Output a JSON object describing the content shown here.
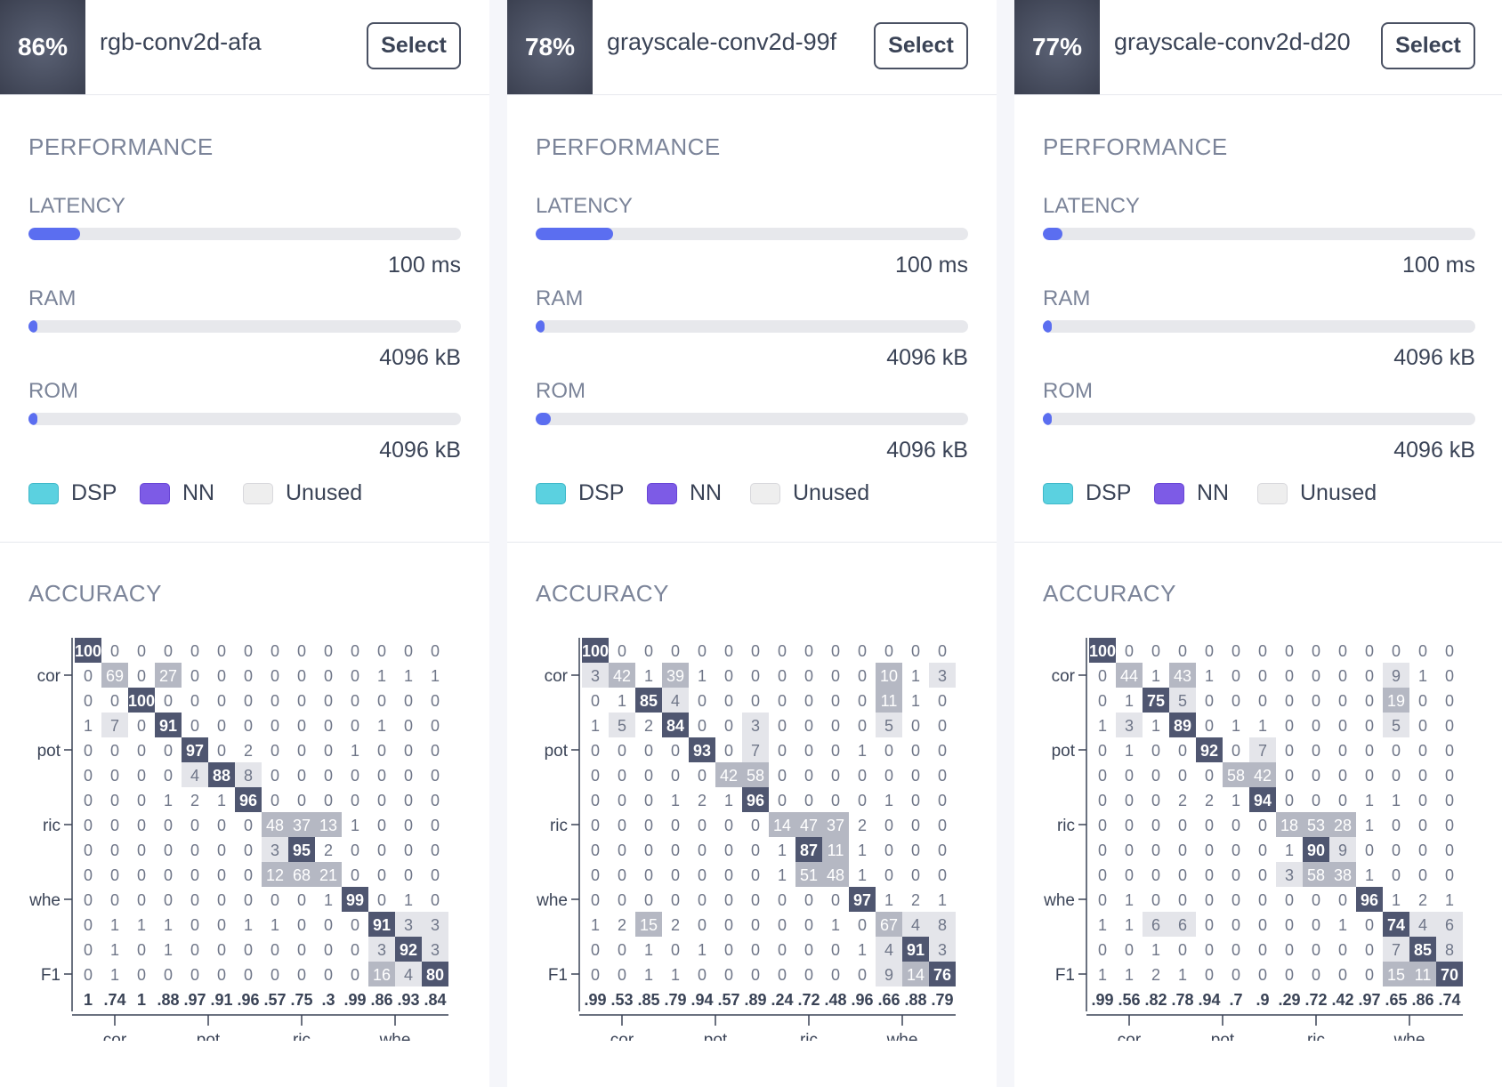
{
  "labels": {
    "select": "Select",
    "performance": "PERFORMANCE",
    "latency": "LATENCY",
    "ram": "RAM",
    "rom": "ROM",
    "accuracy": "ACCURACY",
    "legend": {
      "dsp": "DSP",
      "nn": "NN",
      "unused": "Unused"
    }
  },
  "colors": {
    "dsp": "#5bd1e0",
    "nn": "#7d5be6",
    "unused": "#eeeeee",
    "bar": "#5b6ef0",
    "badge": "#444a5b"
  },
  "models": [
    {
      "accuracy": "86%",
      "name": "rgb-conv2d-afa",
      "latency": {
        "value": "100 ms",
        "fraction": 0.12
      },
      "ram": {
        "value": "4096 kB",
        "fraction": 0.02
      },
      "rom": {
        "value": "4096 kB",
        "fraction": 0.02
      },
      "matrix": [
        [
          "100",
          "0",
          "0",
          "0",
          "0",
          "0",
          "0",
          "0",
          "0",
          "0",
          "0",
          "0",
          "0",
          "0"
        ],
        [
          "0",
          "69",
          "0",
          "27",
          "0",
          "0",
          "0",
          "0",
          "0",
          "0",
          "0",
          "1",
          "1",
          "1"
        ],
        [
          "0",
          "0",
          "100",
          "0",
          "0",
          "0",
          "0",
          "0",
          "0",
          "0",
          "0",
          "0",
          "0",
          "0"
        ],
        [
          "1",
          "7",
          "0",
          "91",
          "0",
          "0",
          "0",
          "0",
          "0",
          "0",
          "0",
          "1",
          "0",
          "0"
        ],
        [
          "0",
          "0",
          "0",
          "0",
          "97",
          "0",
          "2",
          "0",
          "0",
          "0",
          "1",
          "0",
          "0",
          "0"
        ],
        [
          "0",
          "0",
          "0",
          "0",
          "4",
          "88",
          "8",
          "0",
          "0",
          "0",
          "0",
          "0",
          "0",
          "0"
        ],
        [
          "0",
          "0",
          "0",
          "1",
          "2",
          "1",
          "96",
          "0",
          "0",
          "0",
          "0",
          "0",
          "0",
          "0"
        ],
        [
          "0",
          "0",
          "0",
          "0",
          "0",
          "0",
          "0",
          "48",
          "37",
          "13",
          "1",
          "0",
          "0",
          "0"
        ],
        [
          "0",
          "0",
          "0",
          "0",
          "0",
          "0",
          "0",
          "3",
          "95",
          "2",
          "0",
          "0",
          "0",
          "0"
        ],
        [
          "0",
          "0",
          "0",
          "0",
          "0",
          "0",
          "0",
          "12",
          "68",
          "21",
          "0",
          "0",
          "0",
          "0"
        ],
        [
          "0",
          "0",
          "0",
          "0",
          "0",
          "0",
          "0",
          "0",
          "0",
          "1",
          "99",
          "0",
          "1",
          "0"
        ],
        [
          "0",
          "1",
          "1",
          "1",
          "0",
          "0",
          "1",
          "1",
          "0",
          "0",
          "0",
          "91",
          "3",
          "3"
        ],
        [
          "0",
          "1",
          "0",
          "1",
          "0",
          "0",
          "0",
          "0",
          "0",
          "0",
          "0",
          "3",
          "92",
          "3"
        ],
        [
          "0",
          "1",
          "0",
          "0",
          "0",
          "0",
          "0",
          "0",
          "0",
          "0",
          "0",
          "16",
          "4",
          "80"
        ]
      ],
      "f1": [
        "1",
        ".74",
        "1",
        ".88",
        ".97",
        ".91",
        ".96",
        ".57",
        ".75",
        ".3",
        ".99",
        ".86",
        ".93",
        ".84"
      ]
    },
    {
      "accuracy": "78%",
      "name": "grayscale-conv2d-99f",
      "latency": {
        "value": "100 ms",
        "fraction": 0.18
      },
      "ram": {
        "value": "4096 kB",
        "fraction": 0.02
      },
      "rom": {
        "value": "4096 kB",
        "fraction": 0.035
      },
      "matrix": [
        [
          "100",
          "0",
          "0",
          "0",
          "0",
          "0",
          "0",
          "0",
          "0",
          "0",
          "0",
          "0",
          "0",
          "0"
        ],
        [
          "3",
          "42",
          "1",
          "39",
          "1",
          "0",
          "0",
          "0",
          "0",
          "0",
          "0",
          "10",
          "1",
          "3"
        ],
        [
          "0",
          "1",
          "85",
          "4",
          "0",
          "0",
          "0",
          "0",
          "0",
          "0",
          "0",
          "11",
          "1",
          "0"
        ],
        [
          "1",
          "5",
          "2",
          "84",
          "0",
          "0",
          "3",
          "0",
          "0",
          "0",
          "0",
          "5",
          "0",
          "0"
        ],
        [
          "0",
          "0",
          "0",
          "0",
          "93",
          "0",
          "7",
          "0",
          "0",
          "0",
          "1",
          "0",
          "0",
          "0"
        ],
        [
          "0",
          "0",
          "0",
          "0",
          "0",
          "42",
          "58",
          "0",
          "0",
          "0",
          "0",
          "0",
          "0",
          "0"
        ],
        [
          "0",
          "0",
          "0",
          "1",
          "2",
          "1",
          "96",
          "0",
          "0",
          "0",
          "0",
          "1",
          "0",
          "0"
        ],
        [
          "0",
          "0",
          "0",
          "0",
          "0",
          "0",
          "0",
          "14",
          "47",
          "37",
          "2",
          "0",
          "0",
          "0"
        ],
        [
          "0",
          "0",
          "0",
          "0",
          "0",
          "0",
          "0",
          "1",
          "87",
          "11",
          "1",
          "0",
          "0",
          "0"
        ],
        [
          "0",
          "0",
          "0",
          "0",
          "0",
          "0",
          "0",
          "1",
          "51",
          "48",
          "1",
          "0",
          "0",
          "0"
        ],
        [
          "0",
          "0",
          "0",
          "0",
          "0",
          "0",
          "0",
          "0",
          "0",
          "0",
          "97",
          "1",
          "2",
          "1"
        ],
        [
          "1",
          "2",
          "15",
          "2",
          "0",
          "0",
          "0",
          "0",
          "0",
          "1",
          "0",
          "67",
          "4",
          "8"
        ],
        [
          "0",
          "0",
          "1",
          "0",
          "1",
          "0",
          "0",
          "0",
          "0",
          "0",
          "1",
          "4",
          "91",
          "3"
        ],
        [
          "0",
          "0",
          "1",
          "1",
          "0",
          "0",
          "0",
          "0",
          "0",
          "0",
          "0",
          "9",
          "14",
          "76"
        ]
      ],
      "f1": [
        ".99",
        ".53",
        ".85",
        ".79",
        ".94",
        ".57",
        ".89",
        ".24",
        ".72",
        ".48",
        ".96",
        ".66",
        ".88",
        ".79"
      ]
    },
    {
      "accuracy": "77%",
      "name": "grayscale-conv2d-d20",
      "latency": {
        "value": "100 ms",
        "fraction": 0.045
      },
      "ram": {
        "value": "4096 kB",
        "fraction": 0.02
      },
      "rom": {
        "value": "4096 kB",
        "fraction": 0.02
      },
      "matrix": [
        [
          "100",
          "0",
          "0",
          "0",
          "0",
          "0",
          "0",
          "0",
          "0",
          "0",
          "0",
          "0",
          "0",
          "0"
        ],
        [
          "0",
          "44",
          "1",
          "43",
          "1",
          "0",
          "0",
          "0",
          "0",
          "0",
          "0",
          "9",
          "1",
          "0"
        ],
        [
          "0",
          "1",
          "75",
          "5",
          "0",
          "0",
          "0",
          "0",
          "0",
          "0",
          "0",
          "19",
          "0",
          "0"
        ],
        [
          "1",
          "3",
          "1",
          "89",
          "0",
          "1",
          "1",
          "0",
          "0",
          "0",
          "0",
          "5",
          "0",
          "0"
        ],
        [
          "0",
          "1",
          "0",
          "0",
          "92",
          "0",
          "7",
          "0",
          "0",
          "0",
          "0",
          "0",
          "0",
          "0"
        ],
        [
          "0",
          "0",
          "0",
          "0",
          "0",
          "58",
          "42",
          "0",
          "0",
          "0",
          "0",
          "0",
          "0",
          "0"
        ],
        [
          "0",
          "0",
          "0",
          "2",
          "2",
          "1",
          "94",
          "0",
          "0",
          "0",
          "1",
          "1",
          "0",
          "0"
        ],
        [
          "0",
          "0",
          "0",
          "0",
          "0",
          "0",
          "0",
          "18",
          "53",
          "28",
          "1",
          "0",
          "0",
          "0"
        ],
        [
          "0",
          "0",
          "0",
          "0",
          "0",
          "0",
          "0",
          "1",
          "90",
          "9",
          "0",
          "0",
          "0",
          "0"
        ],
        [
          "0",
          "0",
          "0",
          "0",
          "0",
          "0",
          "0",
          "3",
          "58",
          "38",
          "1",
          "0",
          "0",
          "0"
        ],
        [
          "0",
          "1",
          "0",
          "0",
          "0",
          "0",
          "0",
          "0",
          "0",
          "0",
          "96",
          "1",
          "2",
          "1"
        ],
        [
          "1",
          "1",
          "6",
          "6",
          "0",
          "0",
          "0",
          "0",
          "0",
          "1",
          "0",
          "74",
          "4",
          "6"
        ],
        [
          "0",
          "0",
          "1",
          "0",
          "0",
          "0",
          "0",
          "0",
          "0",
          "0",
          "0",
          "7",
          "85",
          "8"
        ],
        [
          "1",
          "1",
          "2",
          "1",
          "0",
          "0",
          "0",
          "0",
          "0",
          "0",
          "0",
          "15",
          "11",
          "70"
        ]
      ],
      "f1": [
        ".99",
        ".56",
        ".82",
        ".78",
        ".94",
        ".7",
        ".9",
        ".29",
        ".72",
        ".42",
        ".97",
        ".65",
        ".86",
        ".74"
      ]
    }
  ],
  "axis": {
    "y_ticks": [
      {
        "row": 1,
        "label": "cor"
      },
      {
        "row": 4,
        "label": "pot"
      },
      {
        "row": 7,
        "label": "ric"
      },
      {
        "row": 10,
        "label": "whe"
      },
      {
        "row": 13,
        "label": "F1"
      }
    ],
    "x_ticks": [
      {
        "col": 1.5,
        "label": "cor"
      },
      {
        "col": 5,
        "label": "pot"
      },
      {
        "col": 8.5,
        "label": "ric"
      },
      {
        "col": 12,
        "label": "whe"
      }
    ]
  }
}
